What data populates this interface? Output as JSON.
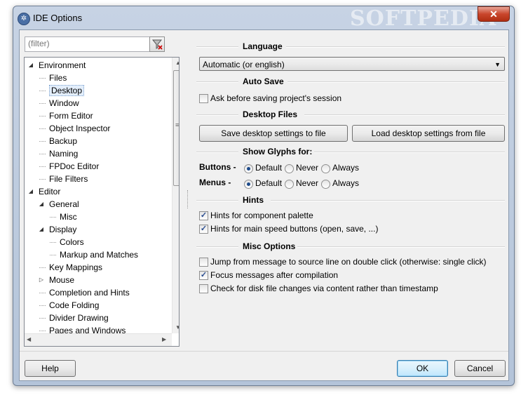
{
  "window": {
    "title": "IDE Options",
    "watermark": "SOFTPEDIA",
    "close": "✕"
  },
  "filter": {
    "placeholder": "(filter)"
  },
  "tree": [
    {
      "label": "Environment",
      "indent": 0,
      "expander": "open"
    },
    {
      "label": "Files",
      "indent": 1
    },
    {
      "label": "Desktop",
      "indent": 1,
      "selected": true
    },
    {
      "label": "Window",
      "indent": 1
    },
    {
      "label": "Form Editor",
      "indent": 1
    },
    {
      "label": "Object Inspector",
      "indent": 1
    },
    {
      "label": "Backup",
      "indent": 1
    },
    {
      "label": "Naming",
      "indent": 1
    },
    {
      "label": "FPDoc Editor",
      "indent": 1
    },
    {
      "label": "File Filters",
      "indent": 1
    },
    {
      "label": "Editor",
      "indent": 0,
      "expander": "open"
    },
    {
      "label": "General",
      "indent": 1,
      "expander": "open"
    },
    {
      "label": "Misc",
      "indent": 2
    },
    {
      "label": "Display",
      "indent": 1,
      "expander": "open"
    },
    {
      "label": "Colors",
      "indent": 2
    },
    {
      "label": "Markup and Matches",
      "indent": 2
    },
    {
      "label": "Key Mappings",
      "indent": 1
    },
    {
      "label": "Mouse",
      "indent": 1,
      "expander": "closed"
    },
    {
      "label": "Completion and Hints",
      "indent": 1
    },
    {
      "label": "Code Folding",
      "indent": 1
    },
    {
      "label": "Divider Drawing",
      "indent": 1
    },
    {
      "label": "Pages and Windows",
      "indent": 1
    }
  ],
  "language": {
    "title": "Language",
    "value": "Automatic (or english)"
  },
  "autosave": {
    "title": "Auto Save",
    "ask_label": "Ask before saving project's session",
    "ask_checked": false
  },
  "desktop_files": {
    "title": "Desktop Files",
    "save_btn": "Save desktop settings to file",
    "load_btn": "Load desktop settings from file"
  },
  "glyphs": {
    "title": "Show Glyphs for:",
    "buttons_label": "Buttons -",
    "menus_label": "Menus -",
    "options": [
      "Default",
      "Never",
      "Always"
    ],
    "buttons_selected": "Default",
    "menus_selected": "Default"
  },
  "hints": {
    "title": "Hints",
    "palette_label": "Hints for component palette",
    "palette_checked": true,
    "speed_label": "Hints for main speed buttons (open, save, ...)",
    "speed_checked": true
  },
  "misc": {
    "title": "Misc Options",
    "jump_label": "Jump from message to source line on double click (otherwise: single click)",
    "jump_checked": false,
    "focus_label": "Focus messages after compilation",
    "focus_checked": true,
    "disk_label": "Check for disk file changes via content rather than timestamp",
    "disk_checked": false
  },
  "footer": {
    "help": "Help",
    "ok": "OK",
    "cancel": "Cancel"
  }
}
